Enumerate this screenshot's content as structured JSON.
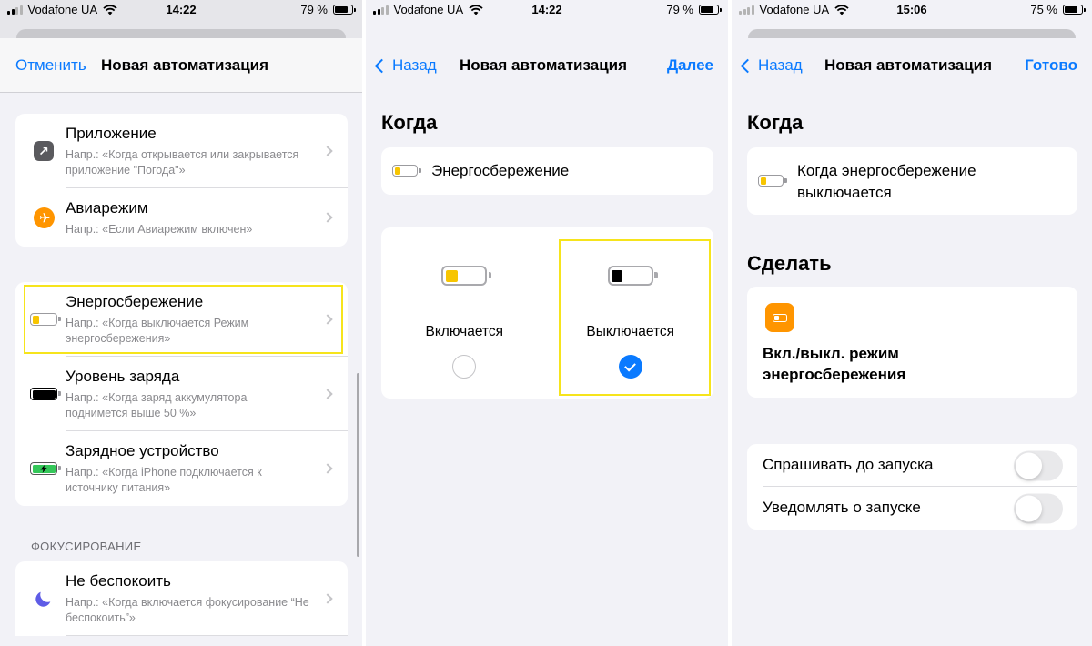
{
  "screens": [
    {
      "status": {
        "carrier": "Vodafone UA",
        "time": "14:22",
        "battery": "79 %",
        "battery_level": 0.79
      },
      "nav": {
        "cancel": "Отменить",
        "title": "Новая автоматизация"
      },
      "group1": [
        {
          "icon": "arrow-up-right-icon",
          "title": "Приложение",
          "sub": "Напр.: «Когда открывается или закрывается приложение \"Погода\"»"
        },
        {
          "icon": "airplane-icon",
          "title": "Авиарежим",
          "sub": "Напр.: «Если Авиарежим включен»"
        }
      ],
      "group2": [
        {
          "icon": "low-power-battery-icon",
          "title": "Энергосбережение",
          "sub": "Напр.: «Когда выключается Режим энергосбережения»"
        },
        {
          "icon": "battery-level-icon",
          "title": "Уровень заряда",
          "sub": "Напр.: «Когда заряд аккумулятора поднимется выше 50 %»"
        },
        {
          "icon": "charging-battery-icon",
          "title": "Зарядное устройство",
          "sub": "Напр.: «Когда iPhone подключается к источнику питания»"
        }
      ],
      "section_focus": "ФОКУСИРОВАНИЕ",
      "group3": [
        {
          "icon": "moon-icon",
          "title": "Не беспокоить",
          "sub": "Напр.: «Когда включается фокусирование “Не беспокоить”»"
        }
      ]
    },
    {
      "status": {
        "carrier": "Vodafone UA",
        "time": "14:22",
        "battery": "79 %",
        "battery_level": 0.79
      },
      "nav": {
        "back": "Назад",
        "title": "Новая автоматизация",
        "next": "Далее"
      },
      "when_header": "Когда",
      "trigger": "Энергосбережение",
      "options": [
        {
          "label": "Включается",
          "selected": false
        },
        {
          "label": "Выключается",
          "selected": true
        }
      ]
    },
    {
      "status": {
        "carrier": "Vodafone UA",
        "time": "15:06",
        "battery": "75 %",
        "battery_level": 0.75
      },
      "nav": {
        "back": "Назад",
        "title": "Новая автоматизация",
        "done": "Готово"
      },
      "when_header": "Когда",
      "trigger": "Когда энергосбережение выключается",
      "do_header": "Сделать",
      "action": "Вкл./выкл. режим энергосбережения",
      "toggles": [
        {
          "label": "Спрашивать до запуска",
          "on": false
        },
        {
          "label": "Уведомлять о запуске",
          "on": false
        }
      ]
    }
  ],
  "colors": {
    "accent": "#0a7aff",
    "highlight": "#f6e41c",
    "low_power_fill": "#f7c500",
    "action_icon": "#ff9500",
    "charging_fill": "#34c759",
    "focus_moon": "#5e5ce6"
  }
}
